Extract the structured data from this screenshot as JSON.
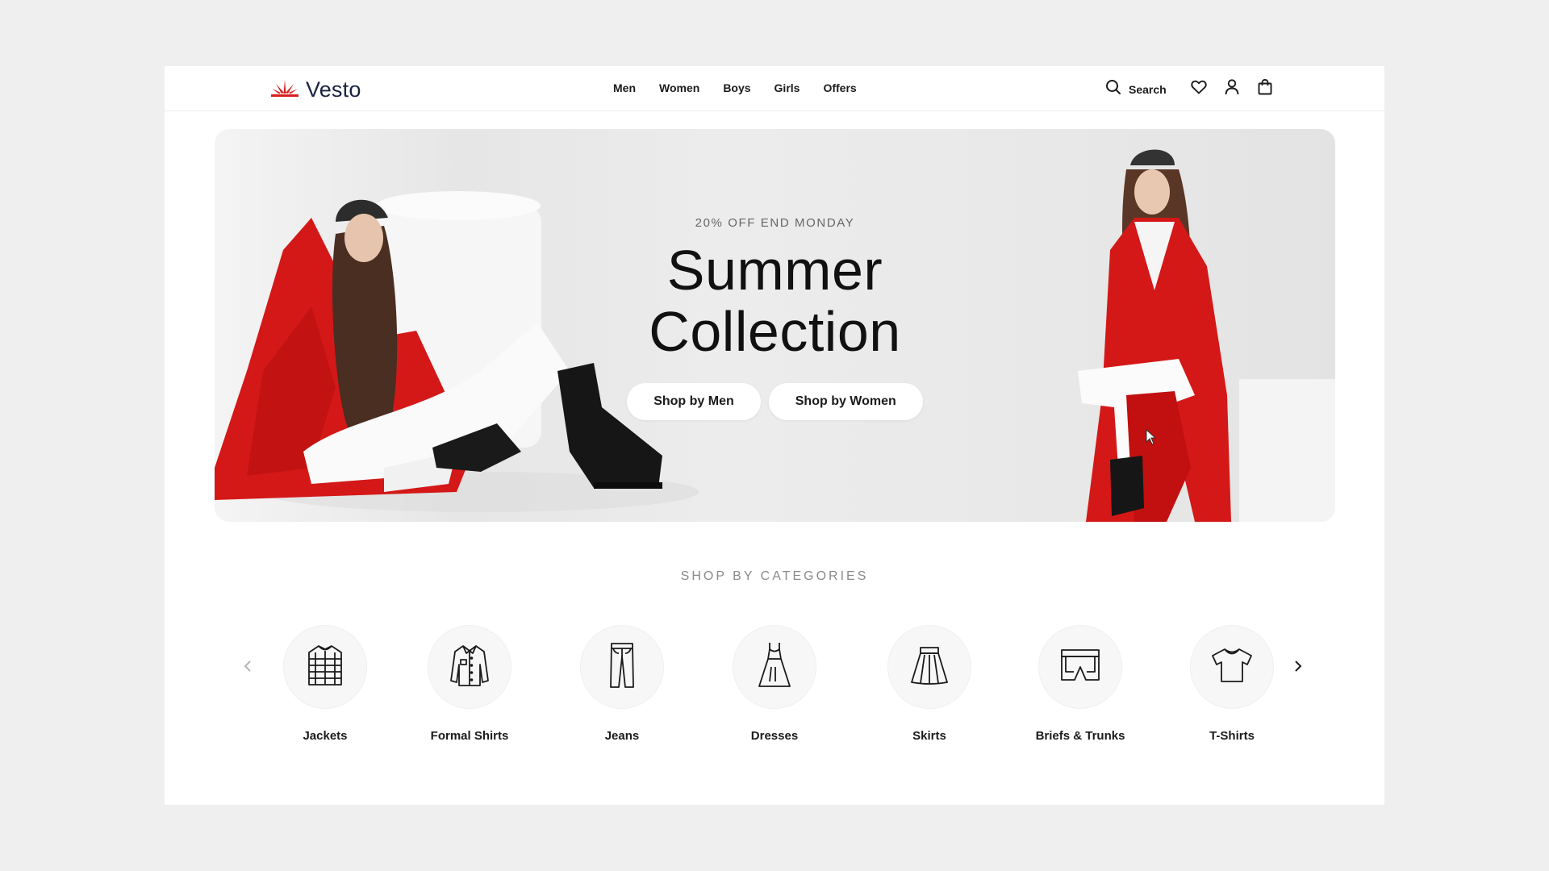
{
  "brand": {
    "name": "Vesto",
    "accent": "#d71f1f"
  },
  "nav": {
    "items": [
      "Men",
      "Women",
      "Boys",
      "Girls",
      "Offers"
    ]
  },
  "header_actions": {
    "search_label": "Search",
    "icons": [
      "search-icon",
      "heart-icon",
      "user-icon",
      "bag-icon"
    ]
  },
  "hero": {
    "eyebrow": "20% OFF END MONDAY",
    "title_line1": "Summer",
    "title_line2": "Collection",
    "buttons": [
      "Shop by Men",
      "Shop by Women"
    ],
    "coat_color": "#d41818"
  },
  "categories": {
    "title": "SHOP BY CATEGORIES",
    "items": [
      {
        "label": "Jackets",
        "icon": "jacket-icon"
      },
      {
        "label": "Formal Shirts",
        "icon": "shirt-icon"
      },
      {
        "label": "Jeans",
        "icon": "jeans-icon"
      },
      {
        "label": "Dresses",
        "icon": "dress-icon"
      },
      {
        "label": "Skirts",
        "icon": "skirt-icon"
      },
      {
        "label": "Briefs & Trunks",
        "icon": "trunks-icon"
      },
      {
        "label": "T-Shirts",
        "icon": "tshirt-icon"
      }
    ]
  }
}
